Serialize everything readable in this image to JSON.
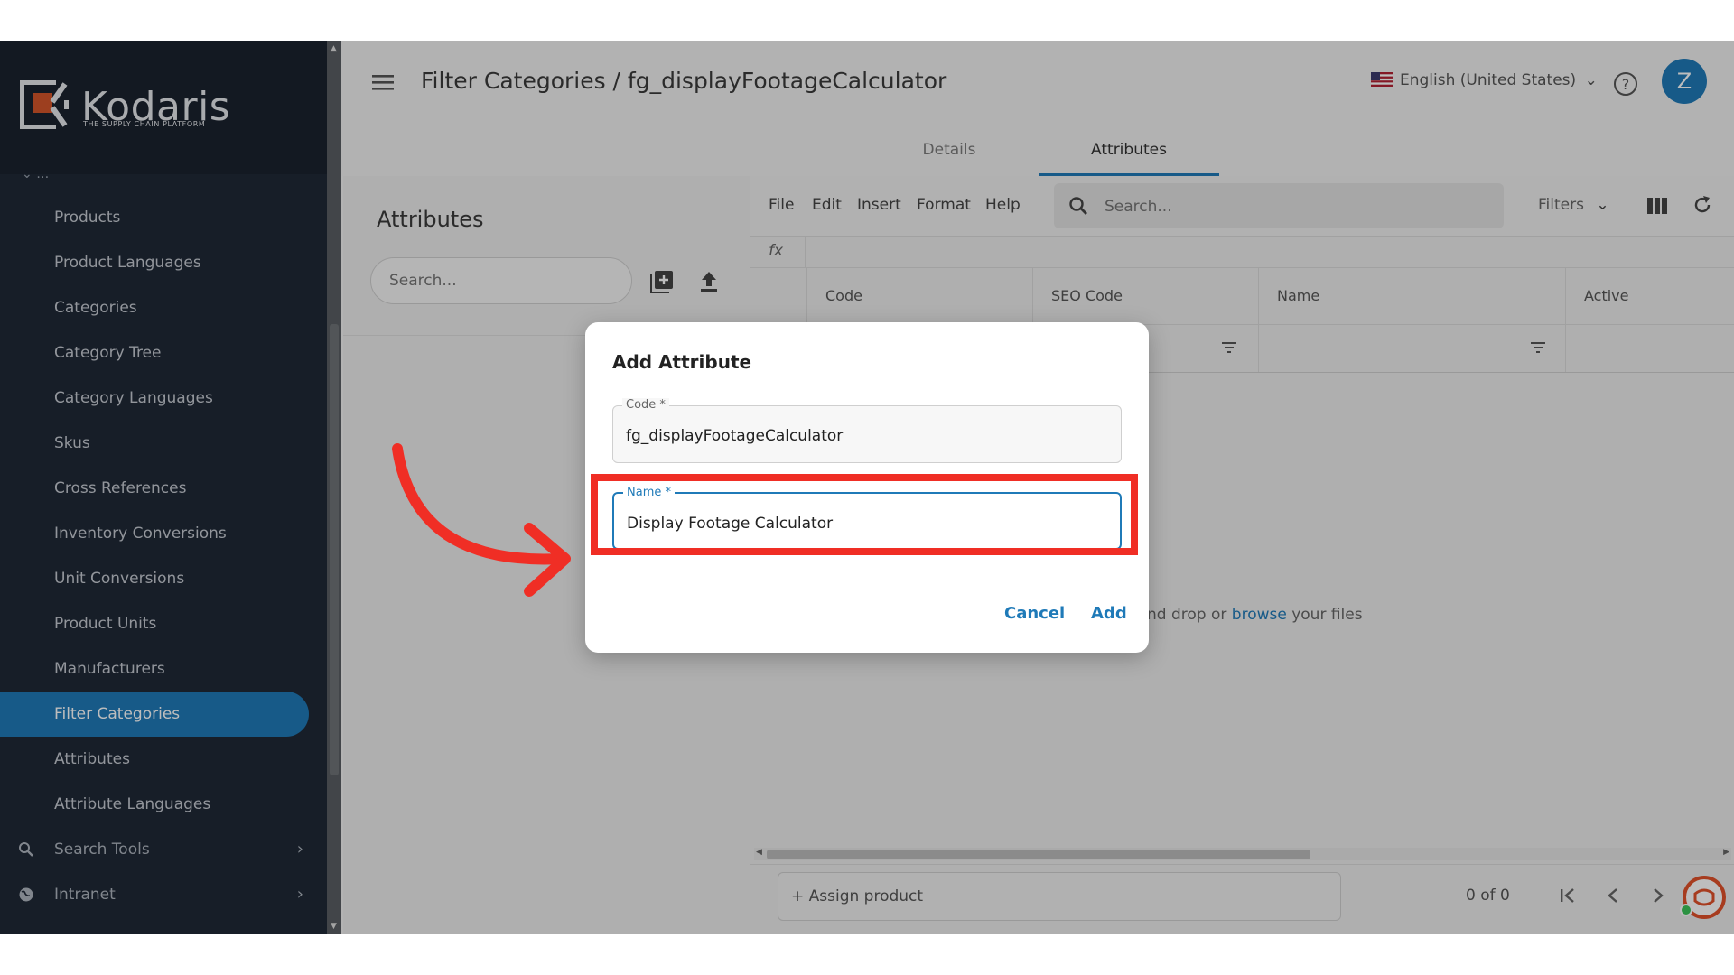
{
  "app": {
    "logo_name": "Kodaris",
    "logo_tagline": "THE SUPPLY CHAIN PLATFORM",
    "accent": "#1f7ab8"
  },
  "sidebar": {
    "partial_label": "…",
    "items": [
      {
        "label": "Products"
      },
      {
        "label": "Product Languages"
      },
      {
        "label": "Categories"
      },
      {
        "label": "Category Tree"
      },
      {
        "label": "Category Languages"
      },
      {
        "label": "Skus"
      },
      {
        "label": "Cross References"
      },
      {
        "label": "Inventory Conversions"
      },
      {
        "label": "Unit Conversions"
      },
      {
        "label": "Product Units"
      },
      {
        "label": "Manufacturers"
      },
      {
        "label": "Filter Categories",
        "active": true
      },
      {
        "label": "Attributes"
      },
      {
        "label": "Attribute Languages"
      }
    ],
    "groups": [
      {
        "label": "Search Tools",
        "icon": "search-icon"
      },
      {
        "label": "Intranet",
        "icon": "globe-icon"
      }
    ]
  },
  "header": {
    "title": "Filter Categories / fg_displayFootageCalculator",
    "language": "English (United States)",
    "avatar_initial": "Z",
    "tabs": [
      {
        "label": "Details"
      },
      {
        "label": "Attributes",
        "active": true
      }
    ]
  },
  "left_panel": {
    "title": "Attributes",
    "search_placeholder": "Search..."
  },
  "grid": {
    "menu": [
      "File",
      "Edit",
      "Insert",
      "Format",
      "Help"
    ],
    "search_placeholder": "Search...",
    "filters_label": "Filters",
    "fx_label": "fx",
    "columns": [
      "Code",
      "SEO Code",
      "Name",
      "Active"
    ],
    "dropzone_before": "g and drop or",
    "dropzone_link": "browse",
    "dropzone_after": "your files",
    "assign_label": "+ Assign product",
    "pager_text": "0 of 0"
  },
  "dialog": {
    "title": "Add Attribute",
    "code_label": "Code *",
    "code_value": "fg_displayFootageCalculator",
    "name_label": "Name *",
    "name_value": "Display Footage Calculator",
    "cancel_label": "Cancel",
    "add_label": "Add"
  },
  "annotation": {
    "color": "#f02e25"
  }
}
